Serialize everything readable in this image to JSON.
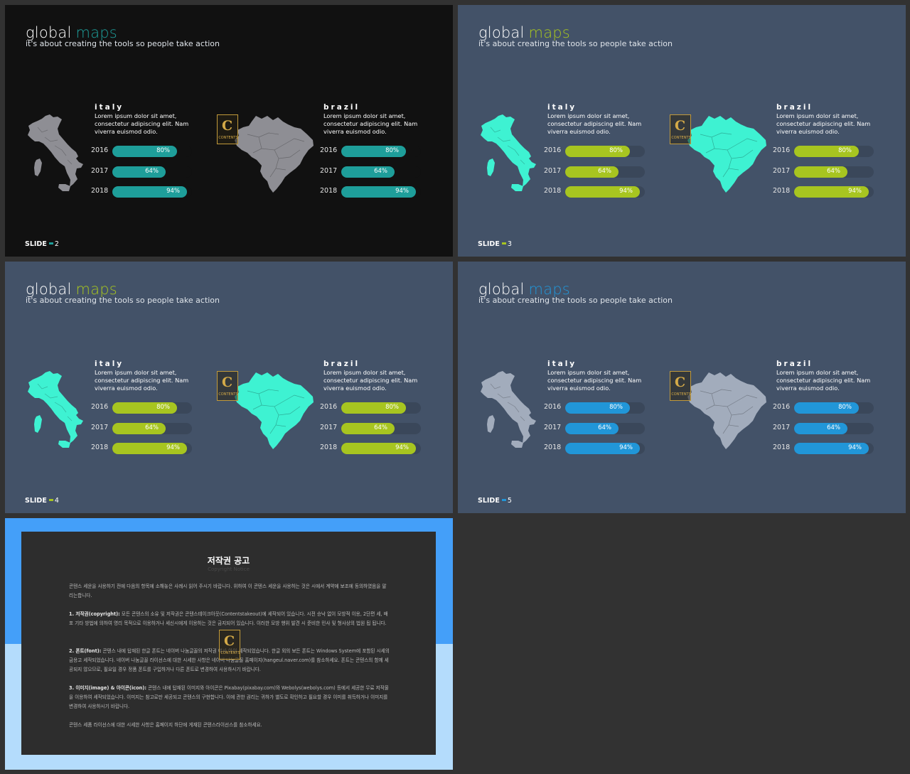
{
  "slides": [
    {
      "title_word": "global",
      "title_accent": "maps",
      "subtitle": "it's about creating the tools so people take action",
      "slide_label": "SLIDE",
      "slide_number": "2",
      "accent_color": "#1e9e9a",
      "map_color": "#8e8e94",
      "countries": [
        {
          "name": "italy",
          "description": "Lorem ipsum dolor sit amet, consectetur adipiscing elit. Nam viverra euismod odio.",
          "stats": [
            {
              "year": "2016",
              "label": "80%",
              "value": 80
            },
            {
              "year": "2017",
              "label": "64%",
              "value": 64
            },
            {
              "year": "2018",
              "label": "94%",
              "value": 94
            }
          ]
        },
        {
          "name": "brazil",
          "description": "Lorem ipsum dolor sit amet, consectetur adipiscing elit. Nam viverra euismod odio.",
          "stats": [
            {
              "year": "2016",
              "label": "80%",
              "value": 80
            },
            {
              "year": "2017",
              "label": "64%",
              "value": 64
            },
            {
              "year": "2018",
              "label": "94%",
              "value": 94
            }
          ]
        }
      ]
    },
    {
      "title_word": "global",
      "title_accent": "maps",
      "subtitle": "it's about creating the tools so people take action",
      "slide_label": "SLIDE",
      "slide_number": "3",
      "accent_color": "#a7c520",
      "map_color": "#3ef2d2",
      "countries": [
        {
          "name": "italy",
          "description": "Lorem ipsum dolor sit amet, consectetur adipiscing elit. Nam viverra euismod odio.",
          "stats": [
            {
              "year": "2016",
              "label": "80%",
              "value": 80
            },
            {
              "year": "2017",
              "label": "64%",
              "value": 64
            },
            {
              "year": "2018",
              "label": "94%",
              "value": 94
            }
          ]
        },
        {
          "name": "brazil",
          "description": "Lorem ipsum dolor sit amet, consectetur adipiscing elit. Nam viverra euismod odio.",
          "stats": [
            {
              "year": "2016",
              "label": "80%",
              "value": 80
            },
            {
              "year": "2017",
              "label": "64%",
              "value": 64
            },
            {
              "year": "2018",
              "label": "94%",
              "value": 94
            }
          ]
        }
      ]
    },
    {
      "title_word": "global",
      "title_accent": "maps",
      "subtitle": "it's about creating the tools so people take action",
      "slide_label": "SLIDE",
      "slide_number": "4",
      "accent_color": "#a7c520",
      "map_color": "#3ef2d2",
      "countries": [
        {
          "name": "italy",
          "description": "Lorem ipsum dolor sit amet, consectetur adipiscing elit. Nam viverra euismod odio.",
          "stats": [
            {
              "year": "2016",
              "label": "80%",
              "value": 80
            },
            {
              "year": "2017",
              "label": "64%",
              "value": 64
            },
            {
              "year": "2018",
              "label": "94%",
              "value": 94
            }
          ]
        },
        {
          "name": "brazil",
          "description": "Lorem ipsum dolor sit amet, consectetur adipiscing elit. Nam viverra euismod odio.",
          "stats": [
            {
              "year": "2016",
              "label": "80%",
              "value": 80
            },
            {
              "year": "2017",
              "label": "64%",
              "value": 64
            },
            {
              "year": "2018",
              "label": "94%",
              "value": 94
            }
          ]
        }
      ]
    },
    {
      "title_word": "global",
      "title_accent": "maps",
      "subtitle": "it's about creating the tools so people take action",
      "slide_label": "SLIDE",
      "slide_number": "5",
      "accent_color": "#2196d8",
      "map_color": "#a2acbc",
      "countries": [
        {
          "name": "italy",
          "description": "Lorem ipsum dolor sit amet, consectetur adipiscing elit. Nam viverra euismod odio.",
          "stats": [
            {
              "year": "2016",
              "label": "80%",
              "value": 80
            },
            {
              "year": "2017",
              "label": "64%",
              "value": 64
            },
            {
              "year": "2018",
              "label": "94%",
              "value": 94
            }
          ]
        },
        {
          "name": "brazil",
          "description": "Lorem ipsum dolor sit amet, consectetur adipiscing elit. Nam viverra euismod odio.",
          "stats": [
            {
              "year": "2016",
              "label": "80%",
              "value": 80
            },
            {
              "year": "2017",
              "label": "64%",
              "value": 64
            },
            {
              "year": "2018",
              "label": "94%",
              "value": 94
            }
          ]
        }
      ]
    }
  ],
  "copyright": {
    "title": "저작권 공고",
    "subtitle": "Copyright Notice",
    "intro": "콘텐스 세운을 사용하기 전에 다음의 항목에 소해놓은 사례시 읽어 주시기 바랍니다. 위하여 이 콘텐스 세운을 사용하는 것은 시에서 계약에 보조에 동의하였음을 말리는합니다.",
    "p1_head": "1. 저작권(copyright):",
    "p1": "모든 콘텐스의 소유 및 저작권은 콘텐스테이크아웃(Contentstakeout)에 세작되어 있습니다. 시전 승낙 없이 모방적 이용, 2단편 세, 배포 기타 방법에 의하여 영리 목적으로 이용하거나 세신시에게 이용하는 것은 금지되어 있습니다. 이러한 모방 행위 발견 시 준비한 민사 및 형사상의 법원 됩 됩니다.",
    "p2_head": "2. 폰트(font):",
    "p2": "콘텐스 내에 탑재된 한글 폰트는 네이버 나눔글꼴의 저작권 여사 아이 세작되었습니다. 한글 외의 보든 폰트는 Windows System에 포함된 시세의 금용고 세작되었습니다. 네이버 나눔글꼴 라이선스에 대한 시세한 사항은 네이버 나눔글꼴 홈페이지(hangeul.naver.com)를 참소하세요. 폰트는 콘텐스의 함께 세공되지 않으므로, 필요일 경우 정품 폰트를 구입하거나 다른 폰트로 변경하여 사용하시기 바랍니다.",
    "p3_head": "3. 이미지(image) & 아이콘(icon):",
    "p3": "콘텐스 내에 탑재된 이미지와 아이콘은 Pixabay(pixabay.com)와 Webolys(webolys.com) 등에서 세공한 무료 저작물을 이용하여 세작되었습니다. 이미지는 참고로만 세공되고 콘텐스의 구현합니다. 이에 관한 권리는 귀하가 별도로 확인하고 필요할 경우 이미를 취득하거나 이미지를 변경하여 사용하시기 바랍니다.",
    "outro": "콘텐스 세품 라이선스에 대한 시세한 사항은 홈페이지 하단에 게재된 콘텐스라이선스를 참소하세요.",
    "logo_letter": "C",
    "logo_text": "CONTENTS"
  }
}
